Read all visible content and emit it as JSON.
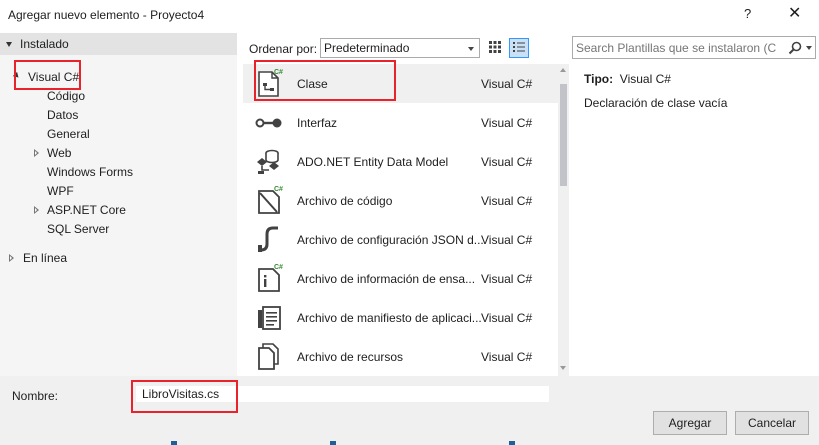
{
  "window": {
    "title": "Agregar nuevo elemento - Proyecto4",
    "help": "?",
    "close": "✕"
  },
  "tree": {
    "installed": "Instalado",
    "visual_csharp": "Visual C#",
    "children": [
      "Código",
      "Datos",
      "General",
      "Web",
      "Windows Forms",
      "WPF",
      "ASP.NET Core",
      "SQL Server"
    ],
    "online": "En línea"
  },
  "toolbar": {
    "sort_label": "Ordenar por:",
    "sort_value": "Predeterminado"
  },
  "templates": [
    {
      "name": "Clase",
      "lang": "Visual C#",
      "icon": "class-icon"
    },
    {
      "name": "Interfaz",
      "lang": "Visual C#",
      "icon": "interface-icon"
    },
    {
      "name": "ADO.NET Entity Data Model",
      "lang": "Visual C#",
      "icon": "entity-model-icon"
    },
    {
      "name": "Archivo de código",
      "lang": "Visual C#",
      "icon": "code-file-icon"
    },
    {
      "name": "Archivo de configuración JSON d...",
      "lang": "Visual C#",
      "icon": "json-config-icon"
    },
    {
      "name": "Archivo de información de ensa...",
      "lang": "Visual C#",
      "icon": "assembly-info-icon"
    },
    {
      "name": "Archivo de manifiesto de aplicaci...",
      "lang": "Visual C#",
      "icon": "manifest-icon"
    },
    {
      "name": "Archivo de recursos",
      "lang": "Visual C#",
      "icon": "resource-file-icon"
    }
  ],
  "search": {
    "placeholder": "Search Plantillas que se instalaron (Ctrl-"
  },
  "details": {
    "type_label": "Tipo:",
    "type_value": "Visual C#",
    "description": "Declaración de clase vacía"
  },
  "footer": {
    "name_label": "Nombre:",
    "name_value": "LibroVisitas.cs",
    "add_label": "Agregar",
    "cancel_label": "Cancelar"
  },
  "colors": {
    "highlight": "#e8232c",
    "csharp_badge": "#388a34",
    "icon_dark": "#424242"
  }
}
